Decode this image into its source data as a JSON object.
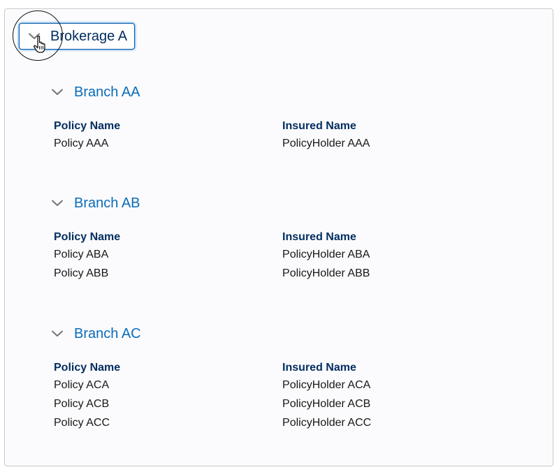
{
  "tree": {
    "root": {
      "label": "Brokerage A",
      "expanded": true,
      "icon": "chevron-down-icon"
    },
    "branches": [
      {
        "label": "Branch AA",
        "columns": [
          "Policy Name",
          "Insured Name"
        ],
        "rows": [
          [
            "Policy AAA",
            "PolicyHolder AAA"
          ]
        ]
      },
      {
        "label": "Branch AB",
        "columns": [
          "Policy Name",
          "Insured Name"
        ],
        "rows": [
          [
            "Policy ABA",
            "PolicyHolder ABA"
          ],
          [
            "Policy ABB",
            "PolicyHolder ABB"
          ]
        ]
      },
      {
        "label": "Branch AC",
        "columns": [
          "Policy Name",
          "Insured Name"
        ],
        "rows": [
          [
            "Policy ACA",
            "PolicyHolder ACA"
          ],
          [
            "Policy ACB",
            "PolicyHolder ACB"
          ],
          [
            "Policy ACC",
            "PolicyHolder ACC"
          ]
        ]
      }
    ]
  },
  "colors": {
    "root_text": "#032d60",
    "branch_text": "#0b6cb8",
    "focus_border": "#0b5cab",
    "chevron": "#747474"
  },
  "cursor": {
    "icon": "hand-pointer-icon",
    "highlight": "click-indicator-ring"
  }
}
